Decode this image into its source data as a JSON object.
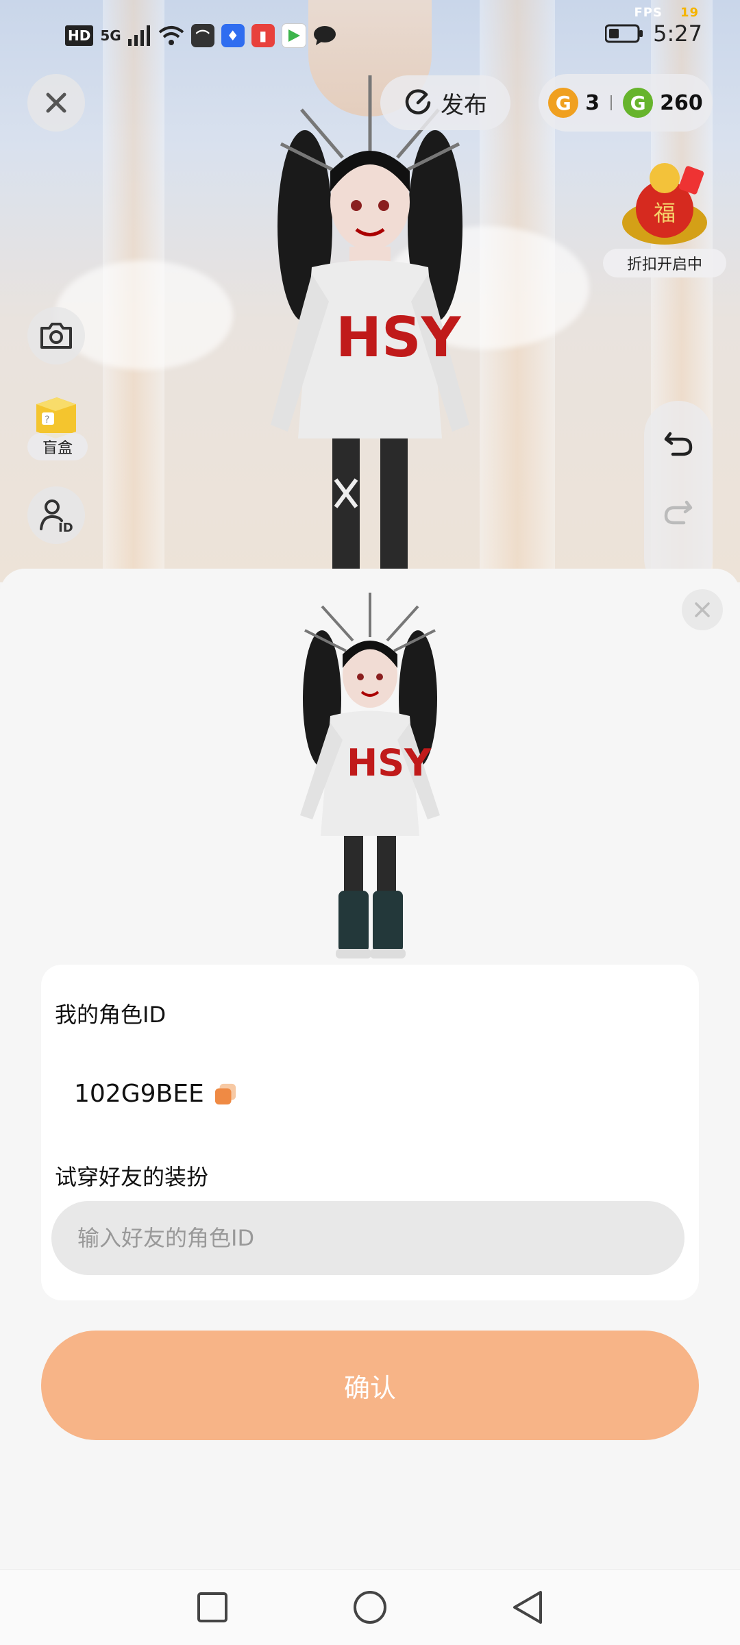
{
  "status_bar": {
    "hd": "HD",
    "network": "5G",
    "time": "5:27",
    "fps_label": "FPS",
    "fps_value": "19"
  },
  "top_bar": {
    "publish_label": "发布",
    "coin_gold": "3",
    "coin_green": "260",
    "discount_label": "折扣开启中"
  },
  "side_tools": {
    "blindbox_label": "盲盒"
  },
  "sheet": {
    "my_id_label": "我的角色ID",
    "my_id_value": "102G9BEE",
    "tryon_label": "试穿好友的装扮",
    "friend_id_placeholder": "输入好友的角色ID",
    "confirm_label": "确认"
  },
  "colors": {
    "confirm_bg": "#f7b487",
    "coin_gold": "#f0a020",
    "coin_green": "#66b42c"
  }
}
